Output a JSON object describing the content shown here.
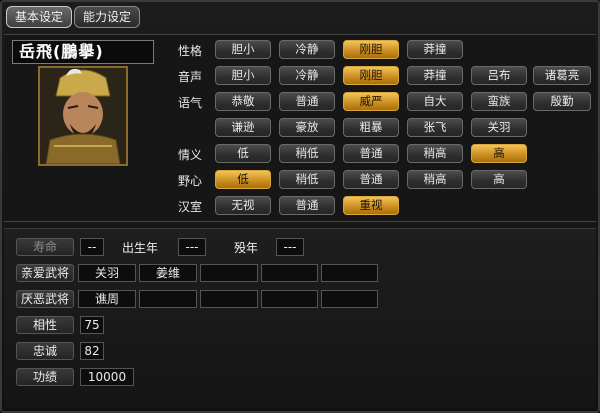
{
  "tabs": [
    "基本设定",
    "能力设定"
  ],
  "officer": {
    "name": "岳飛(鵬擧)"
  },
  "traits": {
    "personality": {
      "label": "性格",
      "options": [
        "胆小",
        "冷静",
        "刚胆",
        "莽撞"
      ],
      "selected": "刚胆"
    },
    "voice": {
      "label": "音声",
      "options": [
        "胆小",
        "冷静",
        "刚胆",
        "莽撞",
        "吕布",
        "诸葛亮"
      ],
      "selected": "刚胆"
    },
    "tone": {
      "label": "语气",
      "options": [
        "恭敬",
        "普通",
        "威严",
        "自大",
        "蛮族",
        "殷勤",
        "谦逊",
        "豪放",
        "粗暴",
        "张飞",
        "关羽"
      ],
      "selected": "威严"
    },
    "loyalty_sense": {
      "label": "情义",
      "options": [
        "低",
        "稍低",
        "普通",
        "稍高",
        "高"
      ],
      "selected": "高"
    },
    "ambition": {
      "label": "野心",
      "options": [
        "低",
        "稍低",
        "普通",
        "稍高",
        "高"
      ],
      "selected": "低"
    },
    "han_dynasty": {
      "label": "汉室",
      "options": [
        "无视",
        "普通",
        "重视"
      ],
      "selected": "重视"
    }
  },
  "stats": {
    "lifespan_label": "寿命",
    "lifespan_value": "--",
    "birth_label": "出生年",
    "birth_value": "---",
    "death_label": "殁年",
    "death_value": "---",
    "liked_label": "亲爱武将",
    "liked": [
      "关羽",
      "姜维",
      "",
      "",
      ""
    ],
    "disliked_label": "厌恶武将",
    "disliked": [
      "谯周",
      "",
      "",
      "",
      ""
    ],
    "affinity_label": "相性",
    "affinity_value": "75",
    "loyalty_label": "忠诚",
    "loyalty_value": "82",
    "merit_label": "功绩",
    "merit_value": "10000"
  },
  "colors": {
    "selected": "#d9a63a",
    "button": "#3a3a3a",
    "background": "#141414"
  }
}
